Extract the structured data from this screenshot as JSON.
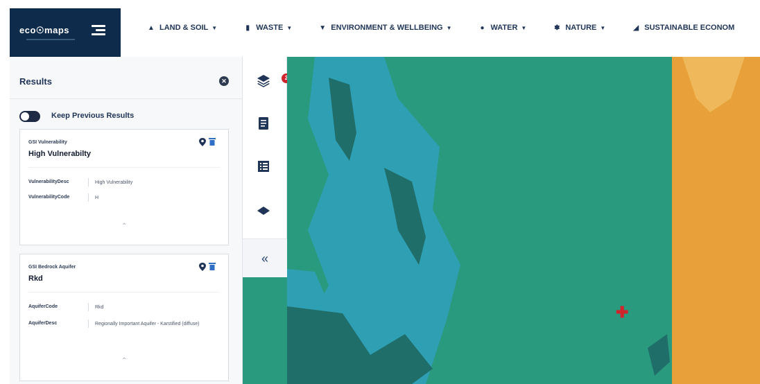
{
  "brand": {
    "logo_text": "eco☉maps",
    "colors": {
      "header_bg": "#0f2b4c",
      "accent_red": "#d0232b",
      "map_green": "#2a9a7e",
      "map_blue": "#2f9fb4",
      "map_orange": "#e8a03a"
    }
  },
  "nav": {
    "items": [
      {
        "label": "LAND & SOIL",
        "icon": "land-icon"
      },
      {
        "label": "WASTE",
        "icon": "waste-icon"
      },
      {
        "label": "ENVIRONMENT & WELLBEING",
        "icon": "environment-icon"
      },
      {
        "label": "WATER",
        "icon": "water-icon"
      },
      {
        "label": "NATURE",
        "icon": "nature-icon"
      },
      {
        "label": "SUSTAINABLE ECONOM",
        "icon": "economy-icon"
      }
    ]
  },
  "results": {
    "title": "Results",
    "keep_previous_label": "Keep Previous Results",
    "cards": [
      {
        "subtitle": "GSI Vulnerability",
        "title": "High Vulnerabilty",
        "rows": [
          {
            "key": "VulnerabilityDesc",
            "value": "High Vulnerability"
          },
          {
            "key": "VulnerabilityCode",
            "value": "H"
          }
        ]
      },
      {
        "subtitle": "GSI Bedrock Aquifer",
        "title": "Rkd",
        "rows": [
          {
            "key": "AquiferCode",
            "value": "Rkd"
          },
          {
            "key": "AquiferDesc",
            "value": "Regionally Important Aquifer - Karstified (diffuse)"
          }
        ]
      }
    ]
  },
  "tools": {
    "layers_badge": "2",
    "collapse_glyph": "«"
  }
}
